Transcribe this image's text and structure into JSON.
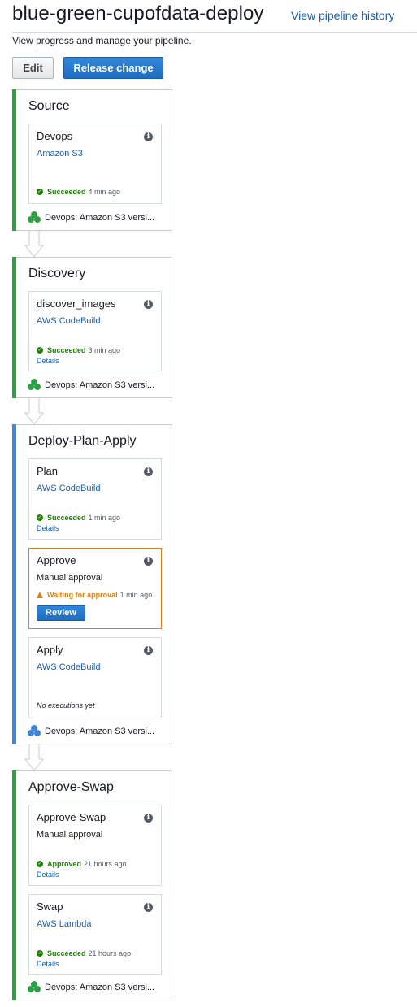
{
  "header": {
    "title": "blue-green-cupofdata-deploy",
    "history_link": "View pipeline history",
    "subtitle": "View progress and manage your pipeline."
  },
  "toolbar": {
    "edit_label": "Edit",
    "release_label": "Release change"
  },
  "colors": {
    "succeeded": "#1d8102",
    "in_progress": "#3f86d6",
    "waiting": "#d68217",
    "link": "#1a5ea8"
  },
  "stages": [
    {
      "name": "Source",
      "status_color": "green",
      "actions": [
        {
          "name": "Devops",
          "provider": "Amazon S3",
          "status": "Succeeded",
          "time": "4 min ago"
        }
      ],
      "artifact": "Devops: Amazon S3 versi..."
    },
    {
      "name": "Discovery",
      "status_color": "green",
      "actions": [
        {
          "name": "discover_images",
          "provider": "AWS CodeBuild",
          "status": "Succeeded",
          "time": "3 min ago",
          "details": "Details"
        }
      ],
      "artifact": "Devops: Amazon S3 versi..."
    },
    {
      "name": "Deploy-Plan-Apply",
      "status_color": "blue",
      "actions": [
        {
          "name": "Plan",
          "provider": "AWS CodeBuild",
          "status": "Succeeded",
          "time": "1 min ago",
          "details": "Details"
        },
        {
          "name": "Approve",
          "provider": "Manual approval",
          "status": "Waiting for approval",
          "time": "1 min ago",
          "button": "Review"
        },
        {
          "name": "Apply",
          "provider": "AWS CodeBuild",
          "note": "No executions yet"
        }
      ],
      "artifact": "Devops: Amazon S3 versi..."
    },
    {
      "name": "Approve-Swap",
      "status_color": "green",
      "actions": [
        {
          "name": "Approve-Swap",
          "provider": "Manual approval",
          "status": "Approved",
          "time": "21 hours ago",
          "details": "Details"
        },
        {
          "name": "Swap",
          "provider": "AWS Lambda",
          "status": "Succeeded",
          "time": "21 hours ago",
          "details": "Details"
        }
      ],
      "artifact": "Devops: Amazon S3 versi..."
    }
  ]
}
